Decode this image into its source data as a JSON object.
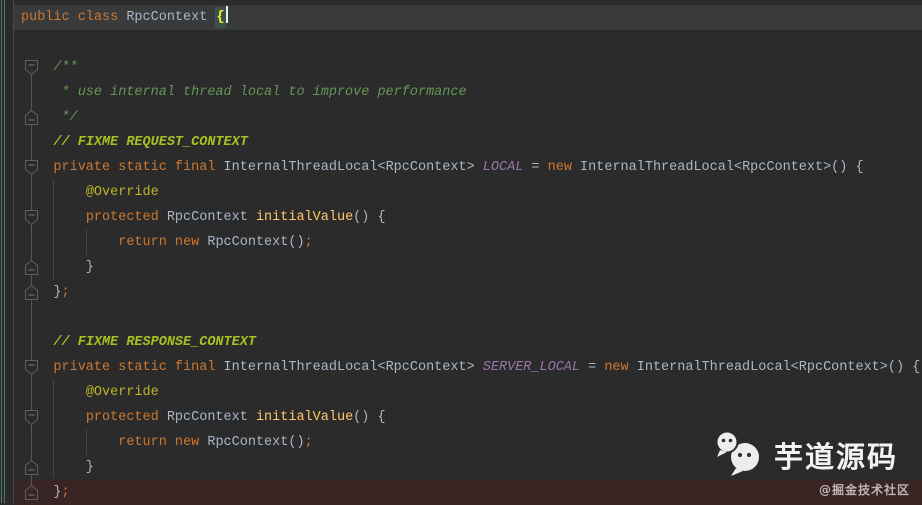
{
  "app": {
    "name": "IntelliJ-style Java editor",
    "file_class": "RpcContext"
  },
  "colors": {
    "background": "#2B2B2B",
    "current_line_bg": "#383A3B",
    "debug_line_bg": "#392523",
    "brace_match_bg": "#3B514D",
    "keyword": "#CC7832",
    "default_text": "#A9B7C6",
    "doc_comment": "#629755",
    "todo_comment": "#A8C023",
    "annotation": "#BBB529",
    "method_name": "#FFC66D",
    "static_field": "#9876AA",
    "semicolon": "#CC7832",
    "matched_brace_text": "#FFEF28",
    "caret": "#ECECEC",
    "vcs_strip": "#4E7A6E",
    "gutter_separator": "#46494A",
    "fold_line": "#53575A",
    "fold_marker_border": "#5C6062",
    "indent_guide": "#414547"
  },
  "editor": {
    "lines": [
      {
        "n": 1,
        "hl": "current",
        "caret": true,
        "segs": [
          [
            "kw",
            "public class "
          ],
          [
            "def",
            "RpcContext "
          ],
          [
            "brace",
            "{"
          ]
        ]
      },
      {
        "n": 2,
        "segs": []
      },
      {
        "n": 3,
        "segs": [
          [
            "doc",
            "    /**"
          ]
        ]
      },
      {
        "n": 4,
        "segs": [
          [
            "doc",
            "     * use internal thread local to improve performance"
          ]
        ]
      },
      {
        "n": 5,
        "segs": [
          [
            "doc",
            "     */"
          ]
        ]
      },
      {
        "n": 6,
        "segs": [
          [
            "todo",
            "    // FIXME REQUEST_CONTEXT"
          ]
        ]
      },
      {
        "n": 7,
        "segs": [
          [
            "def",
            "    "
          ],
          [
            "kw",
            "private static final "
          ],
          [
            "def",
            "InternalThreadLocal<RpcContext> "
          ],
          [
            "fld",
            "LOCAL"
          ],
          [
            "def",
            " = "
          ],
          [
            "kw",
            "new"
          ],
          [
            "def",
            " InternalThreadLocal<RpcContext>() {"
          ]
        ]
      },
      {
        "n": 8,
        "segs": [
          [
            "def",
            "        "
          ],
          [
            "ann",
            "@Override"
          ]
        ]
      },
      {
        "n": 9,
        "segs": [
          [
            "def",
            "        "
          ],
          [
            "kw",
            "protected "
          ],
          [
            "def",
            "RpcContext "
          ],
          [
            "mth",
            "initialValue"
          ],
          [
            "def",
            "() {"
          ]
        ]
      },
      {
        "n": 10,
        "segs": [
          [
            "def",
            "            "
          ],
          [
            "kw",
            "return new "
          ],
          [
            "def",
            "RpcContext()"
          ],
          [
            "semi",
            ";"
          ]
        ]
      },
      {
        "n": 11,
        "segs": [
          [
            "def",
            "        }"
          ]
        ]
      },
      {
        "n": 12,
        "segs": [
          [
            "def",
            "    }"
          ],
          [
            "semi",
            ";"
          ]
        ]
      },
      {
        "n": 13,
        "segs": []
      },
      {
        "n": 14,
        "segs": [
          [
            "todo",
            "    // FIXME RESPONSE_CONTEXT"
          ]
        ]
      },
      {
        "n": 15,
        "segs": [
          [
            "def",
            "    "
          ],
          [
            "kw",
            "private static final "
          ],
          [
            "def",
            "InternalThreadLocal<RpcContext> "
          ],
          [
            "fld",
            "SERVER_LOCAL"
          ],
          [
            "def",
            " = "
          ],
          [
            "kw",
            "new"
          ],
          [
            "def",
            " InternalThreadLocal<RpcContext>() {"
          ]
        ]
      },
      {
        "n": 16,
        "segs": [
          [
            "def",
            "        "
          ],
          [
            "ann",
            "@Override"
          ]
        ]
      },
      {
        "n": 17,
        "segs": [
          [
            "def",
            "        "
          ],
          [
            "kw",
            "protected "
          ],
          [
            "def",
            "RpcContext "
          ],
          [
            "mth",
            "initialValue"
          ],
          [
            "def",
            "() {"
          ]
        ]
      },
      {
        "n": 18,
        "segs": [
          [
            "def",
            "            "
          ],
          [
            "kw",
            "return new "
          ],
          [
            "def",
            "RpcContext()"
          ],
          [
            "semi",
            ";"
          ]
        ]
      },
      {
        "n": 19,
        "segs": [
          [
            "def",
            "        }"
          ]
        ]
      },
      {
        "n": 20,
        "hl": "debug",
        "segs": [
          [
            "def",
            "    }"
          ],
          [
            "semi",
            ";"
          ]
        ]
      }
    ]
  },
  "gutter": {
    "markers": [
      {
        "line": 3,
        "type": "fold-start"
      },
      {
        "line": 5,
        "type": "fold-end"
      },
      {
        "line": 7,
        "type": "fold-start"
      },
      {
        "line": 9,
        "type": "fold-start"
      },
      {
        "line": 11,
        "type": "fold-end"
      },
      {
        "line": 12,
        "type": "fold-end"
      },
      {
        "line": 15,
        "type": "fold-start"
      },
      {
        "line": 17,
        "type": "fold-start"
      },
      {
        "line": 19,
        "type": "fold-end"
      },
      {
        "line": 20,
        "type": "fold-end",
        "row_bg": "#392523"
      }
    ]
  },
  "watermark": {
    "icon": "wechat-icon",
    "brand_text": "芋道源码",
    "brand_color": "#F2F2F2",
    "credit_text": "@掘金技术社区",
    "credit_color": "#BDB5B2"
  }
}
